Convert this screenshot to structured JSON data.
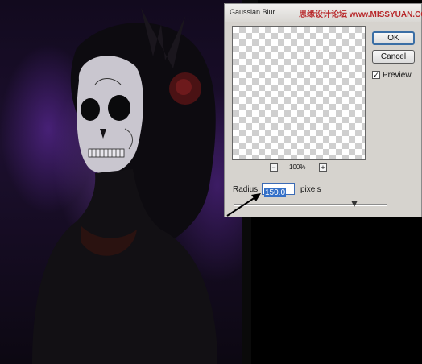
{
  "dialog": {
    "title": "Gaussian Blur",
    "watermark": "思缘设计论坛 www.MISSYUAN.COM",
    "ok_label": "OK",
    "cancel_label": "Cancel",
    "preview_label": "Preview",
    "preview_checked": "✓",
    "zoom_out": "−",
    "zoom_in": "+",
    "zoom_level": "100%",
    "radius_label": "Radius:",
    "radius_value": "150.0",
    "radius_unit": "pixels",
    "radius_slider_level": 0.79
  },
  "colors": {
    "accent": "#3470c8",
    "photo_purple": "#5a2c90",
    "dialog_bg": "#d6d3ce"
  }
}
